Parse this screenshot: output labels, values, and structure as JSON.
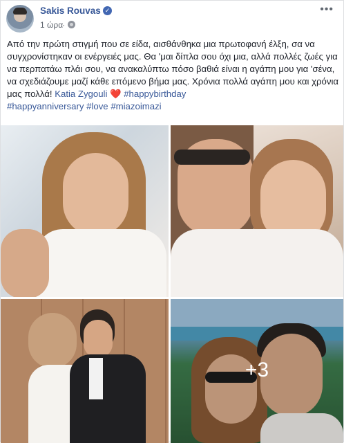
{
  "post": {
    "author": "Sakis Rouvas",
    "time": "1 ώρα",
    "separator": "·",
    "more_icon": "more-horizontal-icon",
    "text_main": "Από την πρώτη στιγμή που σε είδα, αισθάνθηκα μια πρωτοφανή έλξη, σα να συγχρονίστηκαν οι ενέργειές μας. Θα 'μαι δίπλα σου όχι μια, αλλά πολλές ζωές για να περπατάω πλάι σου, να ανακαλύπτω πόσο βαθιά είναι η αγάπη μου για 'σένα, να σχεδιάζουμε μαζί κάθε επόμενο βήμα μας. Χρόνια πολλά αγάπη μου και χρόνια μας πολλά! ",
    "mention": "Katia Zygouli",
    "heart": "❤️",
    "hashtags": [
      "#happybirthday",
      "#happyanniversary",
      "#love",
      "#miazoimazi"
    ],
    "more_photos_count": "+3"
  },
  "colors": {
    "link": "#385898",
    "verified": "#4267b2",
    "meta": "#616770"
  }
}
